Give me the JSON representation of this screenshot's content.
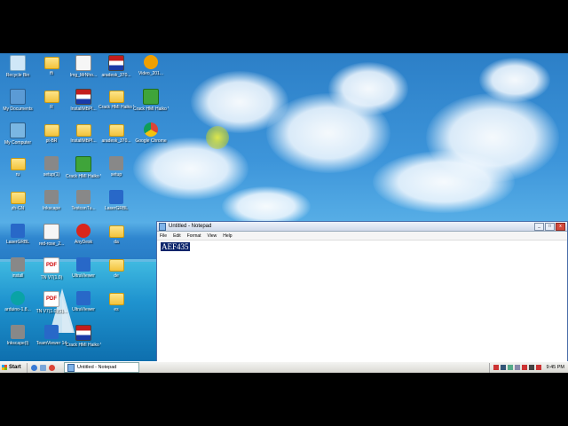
{
  "desktop": {
    "icons": [
      {
        "label": "Recycle Bin",
        "glyph": "bin"
      },
      {
        "label": "ffi",
        "glyph": "folder"
      },
      {
        "label": "Img_MrNho...",
        "glyph": "doc"
      },
      {
        "label": "aradesk_370...",
        "glyph": "flag"
      },
      {
        "label": "Video_201...",
        "glyph": "orange"
      },
      {
        "label": "My Documents",
        "glyph": "docs"
      },
      {
        "label": "R",
        "glyph": "folder"
      },
      {
        "label": "InstallMBPl...",
        "glyph": "flag"
      },
      {
        "label": "Crack HMI Haiko V...",
        "glyph": "folder"
      },
      {
        "label": "Crack HMI Haiko V...",
        "glyph": "green"
      },
      {
        "label": "My Computer",
        "glyph": "pc"
      },
      {
        "label": "pt-BR",
        "glyph": "folder"
      },
      {
        "label": "InstallMBPl...",
        "glyph": "folder"
      },
      {
        "label": "aradesk_370...",
        "glyph": "folder"
      },
      {
        "label": "Google Chrome",
        "glyph": "chrome"
      },
      {
        "label": "ru",
        "glyph": "folder"
      },
      {
        "label": "setup(1)",
        "glyph": "gray"
      },
      {
        "label": "Crack HMI Haiko V...",
        "glyph": "green"
      },
      {
        "label": "setup",
        "glyph": "gray"
      },
      {
        "label": "zh-CN",
        "glyph": "folder"
      },
      {
        "label": "Inkscape",
        "glyph": "gray"
      },
      {
        "label": "TestconTu...",
        "glyph": "gray"
      },
      {
        "label": "LaserGRBL",
        "glyph": "blue"
      },
      {
        "label": "LaserGRBL",
        "glyph": "blue"
      },
      {
        "label": "red-rose_2...",
        "glyph": "doc"
      },
      {
        "label": "AnyDesk",
        "glyph": "red"
      },
      {
        "label": "da",
        "glyph": "folder"
      },
      {
        "label": "install",
        "glyph": "gray"
      },
      {
        "label": "TN V7(1.0)",
        "glyph": "pdf"
      },
      {
        "label": "UltraViewer",
        "glyph": "blue"
      },
      {
        "label": "de",
        "glyph": "folder"
      },
      {
        "label": "arduino-1.8...",
        "glyph": "teal"
      },
      {
        "label": "TN V7(1.0)(1)...",
        "glyph": "pdf"
      },
      {
        "label": "UltraViewer",
        "glyph": "blue"
      },
      {
        "label": "es",
        "glyph": "folder"
      },
      {
        "label": "Inkscape(l)",
        "glyph": "gray"
      },
      {
        "label": "TeamViewer 14",
        "glyph": "blue"
      },
      {
        "label": "Crack HMI Haiko V...",
        "glyph": "flag"
      }
    ]
  },
  "notepad": {
    "title": "Untitled - Notepad",
    "menu": [
      "File",
      "Edit",
      "Format",
      "View",
      "Help"
    ],
    "content": "AEF435",
    "buttons": {
      "minimize": "_",
      "maximize": "□",
      "close": "x"
    }
  },
  "taskbar": {
    "start_label": "Start",
    "task_label": "Untitled - Notepad",
    "clock": "9:45 PM"
  }
}
